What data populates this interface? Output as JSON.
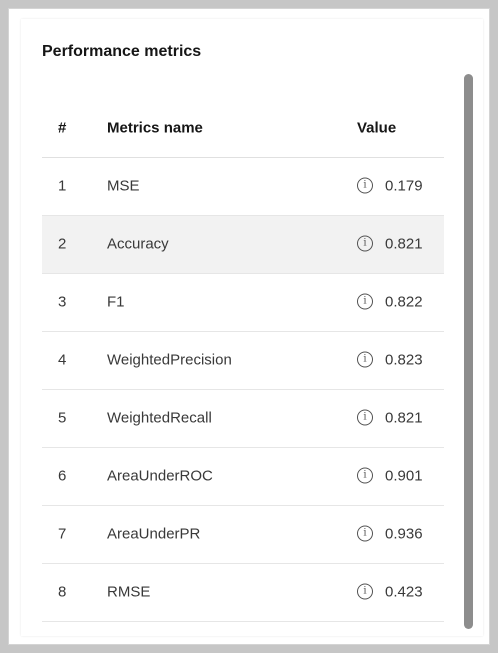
{
  "panel": {
    "title": "Performance metrics"
  },
  "table": {
    "headers": {
      "num": "#",
      "name": "Metrics name",
      "value": "Value"
    },
    "rows": [
      {
        "num": "1",
        "name": "MSE",
        "value": "0.179",
        "icon": "info-icon"
      },
      {
        "num": "2",
        "name": "Accuracy",
        "value": "0.821",
        "icon": "info-icon"
      },
      {
        "num": "3",
        "name": "F1",
        "value": "0.822",
        "icon": "info-icon"
      },
      {
        "num": "4",
        "name": "WeightedPrecision",
        "value": "0.823",
        "icon": "info-icon"
      },
      {
        "num": "5",
        "name": "WeightedRecall",
        "value": "0.821",
        "icon": "info-icon"
      },
      {
        "num": "6",
        "name": "AreaUnderROC",
        "value": "0.901",
        "icon": "info-icon"
      },
      {
        "num": "7",
        "name": "AreaUnderPR",
        "value": "0.936",
        "icon": "info-icon"
      },
      {
        "num": "8",
        "name": "RMSE",
        "value": "0.423",
        "icon": "info-icon"
      }
    ],
    "hovered_row": 2
  },
  "colors": {
    "background": "#c6c6c6",
    "card": "#ffffff",
    "row_hover": "#f2f2f2",
    "scrollbar": "#8d8d8d",
    "text_primary": "#161616",
    "text_secondary": "#393939"
  }
}
